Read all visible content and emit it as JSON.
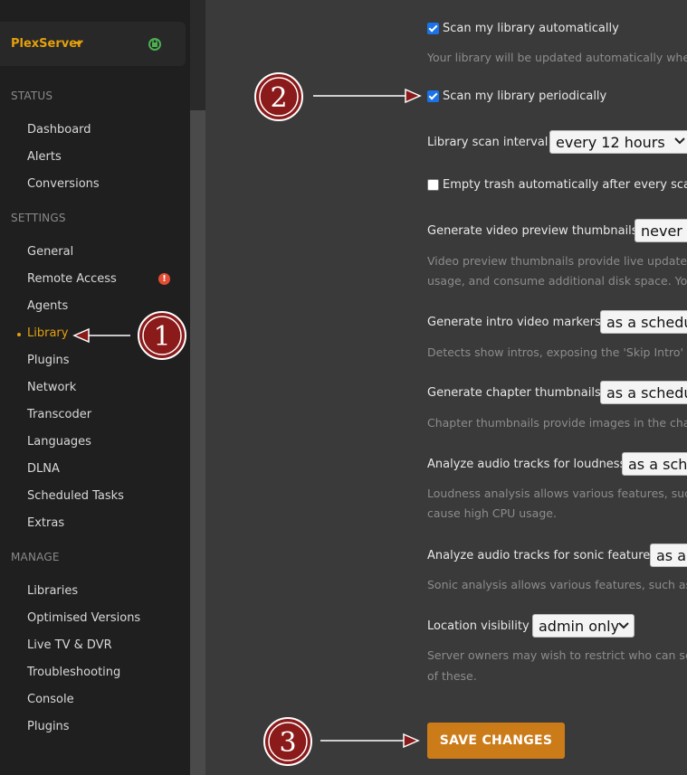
{
  "sidebar": {
    "server_name": "PlexServer",
    "status_heading": "STATUS",
    "status_items": [
      "Dashboard",
      "Alerts",
      "Conversions"
    ],
    "settings_heading": "SETTINGS",
    "settings_items": [
      "General",
      "Remote Access",
      "Agents",
      "Library",
      "Plugins",
      "Network",
      "Transcoder",
      "Languages",
      "DLNA",
      "Scheduled Tasks",
      "Extras"
    ],
    "active_item": "Library",
    "remote_access_badge": "!",
    "manage_heading": "MANAGE",
    "manage_items": [
      "Libraries",
      "Optimised Versions",
      "Live TV & DVR",
      "Troubleshooting",
      "Console",
      "Plugins"
    ]
  },
  "settings": {
    "scan_auto": {
      "label": "Scan my library automatically",
      "checked": true,
      "help": "Your library will be updated automatically when"
    },
    "scan_periodic": {
      "label": "Scan my library periodically",
      "checked": true
    },
    "scan_interval": {
      "label": "Library scan interval",
      "value": "every 12 hours"
    },
    "empty_trash": {
      "label": "Empty trash automatically after every scan",
      "checked": false
    },
    "video_preview": {
      "label": "Generate video preview thumbnails",
      "value": "never",
      "help1": "Video preview thumbnails provide live updates",
      "help2": "usage, and consume additional disk space. You"
    },
    "intro_markers": {
      "label": "Generate intro video markers",
      "value": "as a schedul",
      "help": "Detects show intros, exposing the 'Skip Intro' bu"
    },
    "chapter_thumbs": {
      "label": "Generate chapter thumbnails",
      "value": "as a schedul",
      "help": "Chapter thumbnails provide images in the chap"
    },
    "loudness": {
      "label": "Analyze audio tracks for loudness",
      "value": "as a sche",
      "help1": "Loudness analysis allows various features, such",
      "help2": "cause high CPU usage."
    },
    "sonic": {
      "label": "Analyze audio tracks for sonic features",
      "value": "as a",
      "help": "Sonic analysis allows various features, such as t"
    },
    "location": {
      "label": "Location visibility",
      "value": "admin only",
      "help1": "Server owners may wish to restrict who can see",
      "help2": "of these."
    },
    "save_label": "SAVE CHANGES"
  },
  "annotations": {
    "one": "1",
    "two": "2",
    "three": "3"
  },
  "colors": {
    "accent": "#e5a00d",
    "save_button": "#cc7b19",
    "annotation": "#8b1a1a",
    "checkbox": "#1a73e8"
  }
}
